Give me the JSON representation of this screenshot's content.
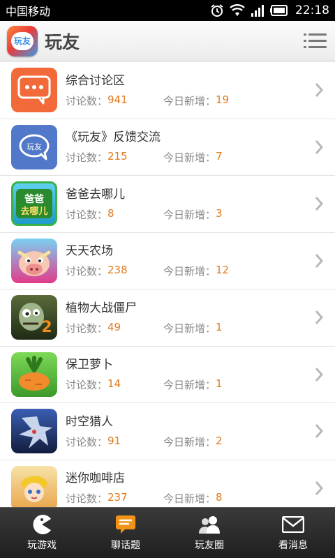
{
  "status_bar": {
    "carrier": "中国移动",
    "time": "22:18",
    "icons": [
      "alarm-icon",
      "wifi-icon",
      "signal-icon",
      "battery-icon"
    ]
  },
  "header": {
    "logo_text": "玩友",
    "title": "玩友",
    "menu_icon": "menu-icon"
  },
  "stats_labels": {
    "discussions": "讨论数：",
    "today_new": "今日新增："
  },
  "forums": [
    {
      "name": "综合讨论区",
      "discussions": "941",
      "today_new": "19",
      "icon": "chat-bubble-icon"
    },
    {
      "name": "《玩友》反馈交流",
      "discussions": "215",
      "today_new": "7",
      "icon": "feedback-bubble-icon"
    },
    {
      "name": "爸爸去哪儿",
      "discussions": "8",
      "today_new": "3",
      "icon": "game-baba-icon"
    },
    {
      "name": "天天农场",
      "discussions": "238",
      "today_new": "12",
      "icon": "game-farm-icon"
    },
    {
      "name": "植物大战僵尸",
      "discussions": "49",
      "today_new": "1",
      "icon": "game-pvz-icon"
    },
    {
      "name": "保卫萝卜",
      "discussions": "14",
      "today_new": "1",
      "icon": "game-carrot-icon"
    },
    {
      "name": "时空猎人",
      "discussions": "91",
      "today_new": "2",
      "icon": "game-hunter-icon"
    },
    {
      "name": "迷你咖啡店",
      "discussions": "237",
      "today_new": "8",
      "icon": "game-cafe-icon"
    }
  ],
  "bottom_nav": [
    {
      "label": "玩游戏",
      "icon": "pacman-icon",
      "active": false
    },
    {
      "label": "聊话题",
      "icon": "topic-bubble-icon",
      "active": true
    },
    {
      "label": "玩友圈",
      "icon": "friends-icon",
      "active": false
    },
    {
      "label": "看消息",
      "icon": "mail-icon",
      "active": false
    }
  ],
  "colors": {
    "accent": "#e07b1e",
    "active_tab_icon": "#f29318",
    "header_bg": "#f5f5f5",
    "nav_bg": "#2b2b2b"
  }
}
